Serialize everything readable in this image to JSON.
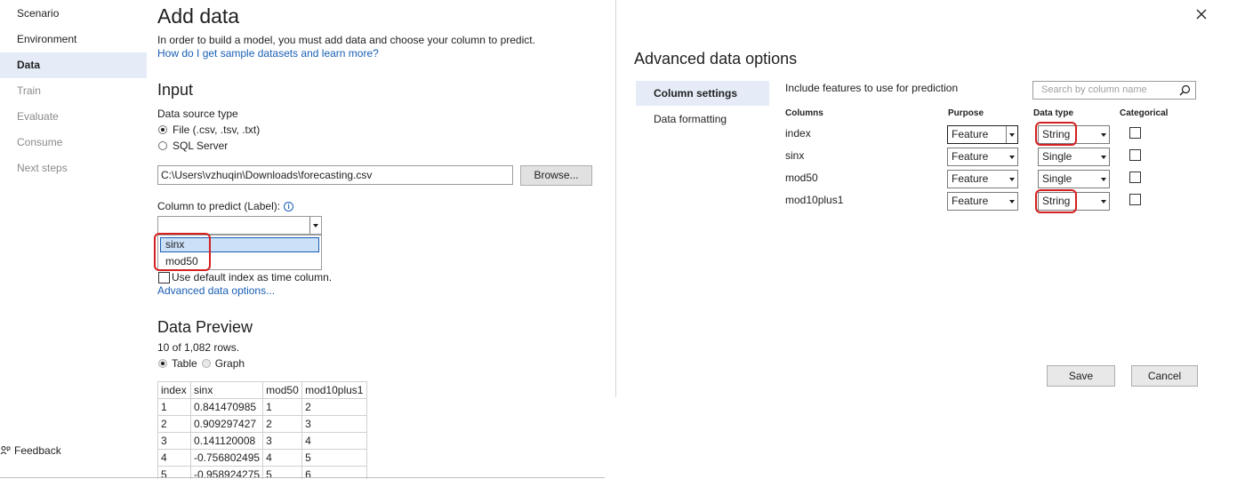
{
  "nav": {
    "items": [
      {
        "label": "Scenario",
        "state": "normal"
      },
      {
        "label": "Environment",
        "state": "normal"
      },
      {
        "label": "Data",
        "state": "active"
      },
      {
        "label": "Train",
        "state": "disabled"
      },
      {
        "label": "Evaluate",
        "state": "disabled"
      },
      {
        "label": "Consume",
        "state": "disabled"
      },
      {
        "label": "Next steps",
        "state": "disabled"
      }
    ],
    "feedback_label": "Feedback"
  },
  "add_data": {
    "title": "Add data",
    "description": "In order to build a model, you must add data and choose your column to predict.",
    "help_link": "How do I get sample datasets and learn more?",
    "input_heading": "Input",
    "source_type_label": "Data source type",
    "source_options": [
      {
        "label": "File (.csv, .tsv, .txt)",
        "selected": true
      },
      {
        "label": "SQL Server",
        "selected": false
      }
    ],
    "file_path": "C:\\Users\\vzhuqin\\Downloads\\forecasting.csv",
    "browse_label": "Browse...",
    "column_label": "Column to predict (Label):",
    "column_value": "",
    "column_options": [
      "sinx",
      "mod50"
    ],
    "highlighted_option": "sinx",
    "default_index_label": "Use default index as time column.",
    "advanced_link": "Advanced data options...",
    "preview_heading": "Data Preview",
    "rows_info": "10 of 1,082 rows.",
    "view_options": [
      {
        "label": "Table",
        "selected": true
      },
      {
        "label": "Graph",
        "selected": false
      }
    ],
    "table": {
      "headers": [
        "index",
        "sinx",
        "mod50",
        "mod10plus1"
      ],
      "rows": [
        [
          "1",
          "0.841470985",
          "1",
          "2"
        ],
        [
          "2",
          "0.909297427",
          "2",
          "3"
        ],
        [
          "3",
          "0.141120008",
          "3",
          "4"
        ],
        [
          "4",
          "-0.756802495",
          "4",
          "5"
        ],
        [
          "5",
          "-0.958924275",
          "5",
          "6"
        ]
      ]
    }
  },
  "dialog": {
    "title": "Advanced data options",
    "close_icon": "close-icon",
    "tabs": [
      {
        "label": "Column settings",
        "active": true
      },
      {
        "label": "Data formatting",
        "active": false
      }
    ],
    "instruction": "Include features to use for prediction",
    "search_placeholder": "Search by column name",
    "headers": {
      "columns": "Columns",
      "purpose": "Purpose",
      "data_type": "Data type",
      "categorical": "Categorical"
    },
    "rows": [
      {
        "name": "index",
        "purpose": "Feature",
        "data_type": "String",
        "categorical": false,
        "highlighted": true
      },
      {
        "name": "sinx",
        "purpose": "Feature",
        "data_type": "Single",
        "categorical": false,
        "highlighted": false
      },
      {
        "name": "mod50",
        "purpose": "Feature",
        "data_type": "Single",
        "categorical": false,
        "highlighted": false
      },
      {
        "name": "mod10plus1",
        "purpose": "Feature",
        "data_type": "String",
        "categorical": false,
        "highlighted": true
      }
    ],
    "save_label": "Save",
    "cancel_label": "Cancel"
  },
  "colors": {
    "accent_link": "#1a5fb4",
    "annotation_red": "#d42020",
    "selection_bg": "#e5ecf7"
  }
}
